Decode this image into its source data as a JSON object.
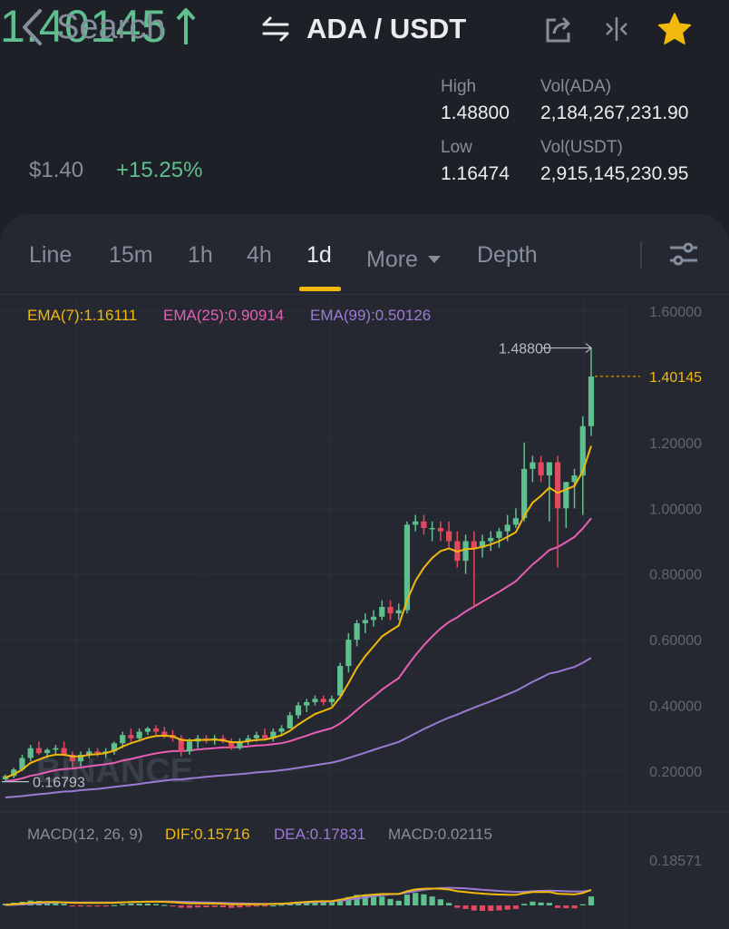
{
  "nav": {
    "back_label": "Search",
    "pair": "ADA / USDT"
  },
  "ticker": {
    "last_price": "1.40145",
    "fiat_price": "$1.40",
    "change": "+15.25%",
    "high_label": "High",
    "high": "1.48800",
    "low_label": "Low",
    "low": "1.16474",
    "vol_base_label": "Vol(ADA)",
    "vol_base": "2,184,267,231.90",
    "vol_quote_label": "Vol(USDT)",
    "vol_quote": "2,915,145,230.95"
  },
  "tabs": [
    "Line",
    "15m",
    "1h",
    "4h",
    "1d",
    "More",
    "Depth"
  ],
  "active_tab": "1d",
  "colors": {
    "up": "#5fbf8e",
    "down": "#e0495f",
    "accent": "#f0b90b",
    "ema7": "#f0b90b",
    "ema25": "#e65fb4",
    "ema99": "#9c7ad4"
  },
  "indicators": {
    "ema7": "EMA(7):1.16111",
    "ema25": "EMA(25):0.90914",
    "ema99": "EMA(99):0.50126",
    "macd_params": "MACD(12, 26, 9)",
    "dif": "DIF:0.15716",
    "dea": "DEA:0.17831",
    "macd": "MACD:0.02115"
  },
  "watermark": "BINANCE",
  "chart_data": {
    "type": "candlestick",
    "y_axis_ticks": [
      "1.60000",
      "1.20000",
      "1.00000",
      "0.80000",
      "0.60000",
      "0.40000",
      "0.20000"
    ],
    "ylim": [
      0.135,
      1.65
    ],
    "max_label": "1.48800",
    "min_label": "0.16793",
    "current_price_label": "1.40145",
    "macd_axis_label": "0.18571",
    "candles": [
      [
        0.175,
        0.19,
        0.16793,
        0.185
      ],
      [
        0.185,
        0.21,
        0.178,
        0.205
      ],
      [
        0.205,
        0.25,
        0.2,
        0.24
      ],
      [
        0.24,
        0.28,
        0.23,
        0.27
      ],
      [
        0.27,
        0.29,
        0.25,
        0.255
      ],
      [
        0.255,
        0.27,
        0.24,
        0.265
      ],
      [
        0.265,
        0.28,
        0.25,
        0.27
      ],
      [
        0.27,
        0.29,
        0.245,
        0.25
      ],
      [
        0.25,
        0.26,
        0.21,
        0.23
      ],
      [
        0.23,
        0.26,
        0.215,
        0.25
      ],
      [
        0.25,
        0.27,
        0.24,
        0.26
      ],
      [
        0.26,
        0.27,
        0.245,
        0.255
      ],
      [
        0.255,
        0.27,
        0.24,
        0.26
      ],
      [
        0.26,
        0.29,
        0.25,
        0.285
      ],
      [
        0.285,
        0.32,
        0.27,
        0.31
      ],
      [
        0.31,
        0.33,
        0.29,
        0.3
      ],
      [
        0.3,
        0.33,
        0.29,
        0.32
      ],
      [
        0.32,
        0.335,
        0.31,
        0.33
      ],
      [
        0.33,
        0.34,
        0.31,
        0.32
      ],
      [
        0.32,
        0.335,
        0.3,
        0.31
      ],
      [
        0.31,
        0.325,
        0.29,
        0.3
      ],
      [
        0.3,
        0.31,
        0.245,
        0.26
      ],
      [
        0.26,
        0.3,
        0.25,
        0.29
      ],
      [
        0.29,
        0.31,
        0.27,
        0.3
      ],
      [
        0.3,
        0.31,
        0.285,
        0.295
      ],
      [
        0.295,
        0.31,
        0.28,
        0.3
      ],
      [
        0.3,
        0.31,
        0.285,
        0.29
      ],
      [
        0.29,
        0.3,
        0.265,
        0.27
      ],
      [
        0.27,
        0.3,
        0.265,
        0.29
      ],
      [
        0.29,
        0.31,
        0.28,
        0.3
      ],
      [
        0.3,
        0.32,
        0.29,
        0.31
      ],
      [
        0.31,
        0.33,
        0.3,
        0.3
      ],
      [
        0.3,
        0.33,
        0.29,
        0.32
      ],
      [
        0.32,
        0.34,
        0.31,
        0.33
      ],
      [
        0.33,
        0.38,
        0.33,
        0.37
      ],
      [
        0.37,
        0.41,
        0.36,
        0.4
      ],
      [
        0.4,
        0.42,
        0.38,
        0.41
      ],
      [
        0.41,
        0.43,
        0.4,
        0.42
      ],
      [
        0.42,
        0.43,
        0.4,
        0.41
      ],
      [
        0.41,
        0.43,
        0.4,
        0.42
      ],
      [
        0.43,
        0.53,
        0.42,
        0.52
      ],
      [
        0.52,
        0.62,
        0.5,
        0.6
      ],
      [
        0.6,
        0.66,
        0.58,
        0.65
      ],
      [
        0.65,
        0.68,
        0.62,
        0.66
      ],
      [
        0.66,
        0.69,
        0.64,
        0.67
      ],
      [
        0.67,
        0.72,
        0.66,
        0.7
      ],
      [
        0.7,
        0.72,
        0.66,
        0.68
      ],
      [
        0.68,
        0.71,
        0.66,
        0.69
      ],
      [
        0.69,
        0.96,
        0.68,
        0.95
      ],
      [
        0.95,
        0.98,
        0.93,
        0.96
      ],
      [
        0.96,
        0.98,
        0.92,
        0.94
      ],
      [
        0.94,
        0.96,
        0.9,
        0.94
      ],
      [
        0.94,
        0.96,
        0.9,
        0.93
      ],
      [
        0.93,
        0.96,
        0.88,
        0.9
      ],
      [
        0.9,
        0.93,
        0.82,
        0.84
      ],
      [
        0.84,
        0.92,
        0.8,
        0.9
      ],
      [
        0.9,
        0.93,
        0.7,
        0.88
      ],
      [
        0.88,
        0.92,
        0.85,
        0.9
      ],
      [
        0.9,
        0.93,
        0.87,
        0.91
      ],
      [
        0.91,
        0.94,
        0.88,
        0.93
      ],
      [
        0.93,
        0.98,
        0.9,
        0.95
      ],
      [
        0.95,
        1.0,
        0.94,
        0.97
      ],
      [
        0.97,
        1.2,
        0.96,
        1.12
      ],
      [
        1.12,
        1.16,
        1.08,
        1.14
      ],
      [
        1.14,
        1.16,
        1.08,
        1.1
      ],
      [
        1.1,
        1.14,
        0.96,
        1.14
      ],
      [
        1.14,
        1.16,
        0.82,
        1.0
      ],
      [
        1.0,
        1.08,
        0.94,
        1.08
      ],
      [
        1.08,
        1.12,
        1.0,
        1.1
      ],
      [
        1.1,
        1.28,
        0.98,
        1.25
      ],
      [
        1.25,
        1.488,
        1.22,
        1.40145
      ]
    ],
    "ema7": [
      0.18,
      0.19,
      0.205,
      0.225,
      0.235,
      0.245,
      0.25,
      0.25,
      0.245,
      0.245,
      0.25,
      0.252,
      0.255,
      0.262,
      0.275,
      0.285,
      0.293,
      0.302,
      0.307,
      0.308,
      0.306,
      0.295,
      0.293,
      0.295,
      0.295,
      0.296,
      0.294,
      0.288,
      0.288,
      0.291,
      0.295,
      0.296,
      0.302,
      0.309,
      0.323,
      0.342,
      0.358,
      0.374,
      0.383,
      0.393,
      0.425,
      0.468,
      0.514,
      0.55,
      0.58,
      0.61,
      0.627,
      0.643,
      0.72,
      0.779,
      0.819,
      0.849,
      0.87,
      0.878,
      0.868,
      0.876,
      0.877,
      0.883,
      0.89,
      0.9,
      0.913,
      0.927,
      0.977,
      1.017,
      1.038,
      1.063,
      1.047,
      1.057,
      1.068,
      1.113,
      1.19
    ],
    "ema25": [
      0.17,
      0.172,
      0.178,
      0.186,
      0.191,
      0.197,
      0.203,
      0.206,
      0.208,
      0.211,
      0.215,
      0.218,
      0.221,
      0.225,
      0.232,
      0.237,
      0.243,
      0.249,
      0.254,
      0.258,
      0.261,
      0.261,
      0.263,
      0.266,
      0.268,
      0.27,
      0.272,
      0.272,
      0.273,
      0.275,
      0.278,
      0.279,
      0.282,
      0.285,
      0.291,
      0.3,
      0.308,
      0.317,
      0.324,
      0.331,
      0.345,
      0.364,
      0.386,
      0.407,
      0.427,
      0.448,
      0.466,
      0.483,
      0.519,
      0.553,
      0.583,
      0.61,
      0.634,
      0.654,
      0.668,
      0.686,
      0.701,
      0.716,
      0.731,
      0.746,
      0.762,
      0.778,
      0.804,
      0.829,
      0.85,
      0.873,
      0.882,
      0.897,
      0.913,
      0.939,
      0.97
    ],
    "ema99": [
      0.12,
      0.122,
      0.124,
      0.127,
      0.13,
      0.132,
      0.135,
      0.138,
      0.139,
      0.142,
      0.144,
      0.146,
      0.149,
      0.152,
      0.155,
      0.158,
      0.161,
      0.165,
      0.168,
      0.171,
      0.174,
      0.175,
      0.178,
      0.18,
      0.183,
      0.185,
      0.187,
      0.189,
      0.191,
      0.193,
      0.196,
      0.198,
      0.2,
      0.203,
      0.206,
      0.21,
      0.214,
      0.218,
      0.222,
      0.226,
      0.232,
      0.24,
      0.248,
      0.256,
      0.265,
      0.273,
      0.281,
      0.289,
      0.302,
      0.315,
      0.328,
      0.34,
      0.352,
      0.363,
      0.372,
      0.383,
      0.393,
      0.403,
      0.413,
      0.423,
      0.434,
      0.444,
      0.458,
      0.472,
      0.484,
      0.497,
      0.502,
      0.51,
      0.517,
      0.53,
      0.545
    ]
  }
}
